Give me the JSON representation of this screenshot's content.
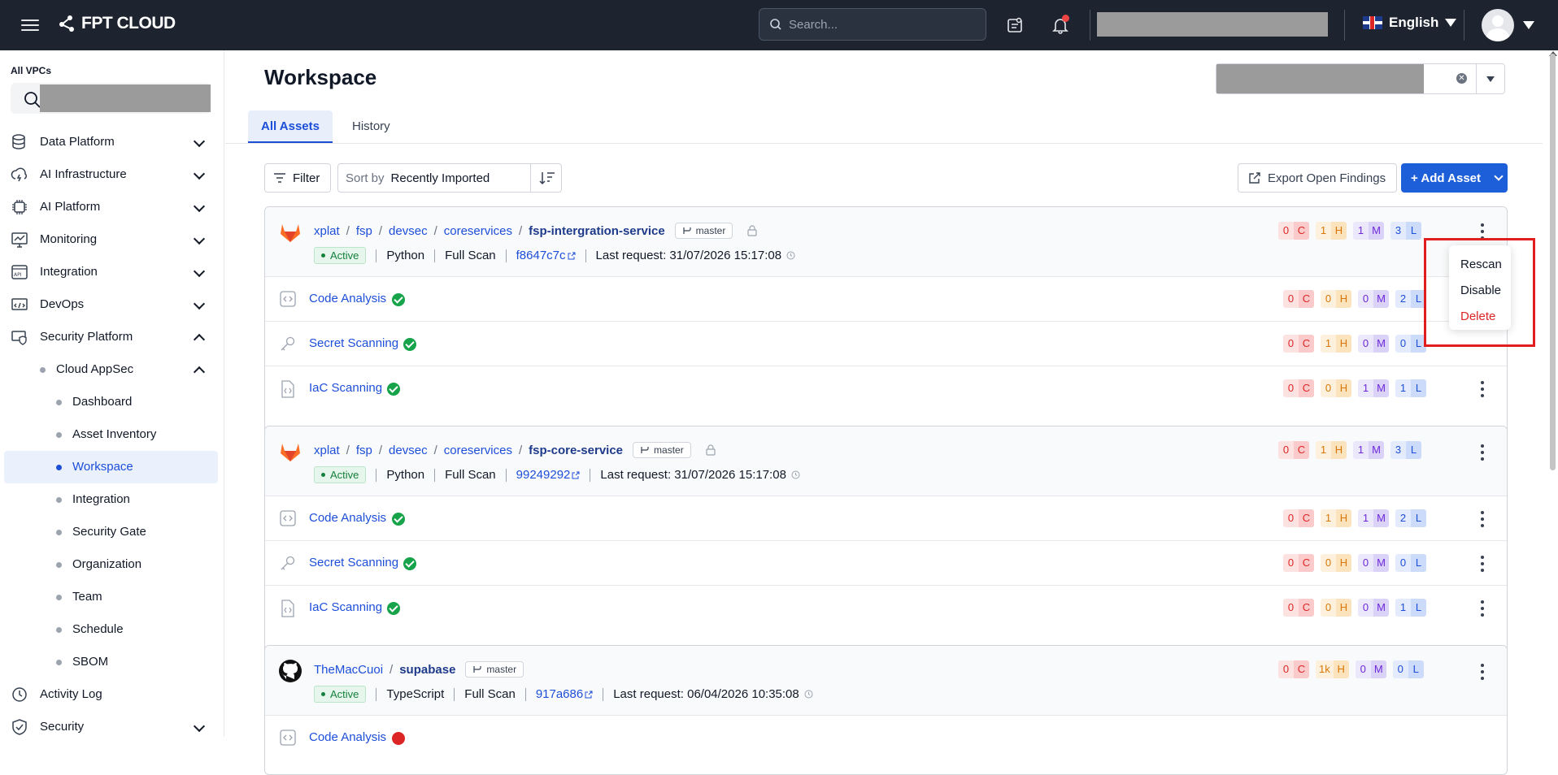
{
  "topbar": {
    "brand": "FPT CLOUD",
    "search_placeholder": "Search...",
    "language": "English"
  },
  "sidebar": {
    "title": "All VPCs",
    "items": [
      {
        "label": "Data Platform",
        "icon": "database-icon",
        "state": "collapsed"
      },
      {
        "label": "AI Infrastructure",
        "icon": "cloud-bolt-icon",
        "state": "collapsed"
      },
      {
        "label": "AI Platform",
        "icon": "ai-chip-icon",
        "state": "collapsed"
      },
      {
        "label": "Monitoring",
        "icon": "monitor-chart-icon",
        "state": "collapsed"
      },
      {
        "label": "Integration",
        "icon": "api-icon",
        "state": "collapsed"
      },
      {
        "label": "DevOps",
        "icon": "devops-icon",
        "state": "collapsed"
      },
      {
        "label": "Security Platform",
        "icon": "shield-icon",
        "state": "expanded"
      }
    ],
    "cloud_appsec": "Cloud AppSec",
    "subitems": [
      "Dashboard",
      "Asset Inventory",
      "Workspace",
      "Integration",
      "Security Gate",
      "Organization",
      "Team",
      "Schedule",
      "SBOM"
    ],
    "active_subitem": "Workspace",
    "activity_log": "Activity Log",
    "security": "Security"
  },
  "main": {
    "title": "Workspace",
    "tabs": [
      "All Assets",
      "History"
    ],
    "active_tab": "All Assets",
    "filter_label": "Filter",
    "sort_label": "Sort by",
    "sort_value": "Recently Imported",
    "export_label": "Export Open Findings",
    "add_label": "+ Add Asset"
  },
  "severity_letters": {
    "c": "C",
    "h": "H",
    "m": "M",
    "l": "L"
  },
  "assets": [
    {
      "path": [
        "xplat",
        "fsp",
        "devsec",
        "coreservices"
      ],
      "name": "fsp-intergration-service",
      "branch": "master",
      "status": "Active",
      "language": "Python",
      "scan": "Full Scan",
      "commit": "f8647c7c",
      "last_request": "Last request: 31/07/2026 15:17:08",
      "counts": {
        "c": "0",
        "h": "1",
        "m": "1",
        "l": "3"
      },
      "rows": [
        {
          "label": "Code Analysis",
          "counts": {
            "c": "0",
            "h": "0",
            "m": "0",
            "l": "2"
          }
        },
        {
          "label": "Secret Scanning",
          "counts": {
            "c": "0",
            "h": "1",
            "m": "0",
            "l": "0"
          }
        },
        {
          "label": "IaC Scanning",
          "counts": {
            "c": "0",
            "h": "0",
            "m": "1",
            "l": "1"
          }
        }
      ]
    },
    {
      "path": [
        "xplat",
        "fsp",
        "devsec",
        "coreservices"
      ],
      "name": "fsp-core-service",
      "branch": "master",
      "status": "Active",
      "language": "Python",
      "scan": "Full Scan",
      "commit": "99249292",
      "last_request": "Last request: 31/07/2026 15:17:08",
      "counts": {
        "c": "0",
        "h": "1",
        "m": "1",
        "l": "3"
      },
      "rows": [
        {
          "label": "Code Analysis",
          "counts": {
            "c": "0",
            "h": "1",
            "m": "1",
            "l": "2"
          }
        },
        {
          "label": "Secret Scanning",
          "counts": {
            "c": "0",
            "h": "0",
            "m": "0",
            "l": "0"
          }
        },
        {
          "label": "IaC Scanning",
          "counts": {
            "c": "0",
            "h": "0",
            "m": "0",
            "l": "1"
          }
        }
      ]
    },
    {
      "path": [
        "TheMacCuoi"
      ],
      "name": "supabase",
      "branch": "master",
      "status": "Active",
      "language": "TypeScript",
      "scan": "Full Scan",
      "commit": "917a686",
      "last_request": "Last request: 06/04/2026 10:35:08",
      "counts": {
        "c": "0",
        "h": "1k",
        "m": "0",
        "l": "0"
      },
      "rows": [
        {
          "label": "Code Analysis"
        }
      ]
    }
  ],
  "context_menu": {
    "items": [
      "Rescan",
      "Disable",
      "Delete"
    ],
    "danger_color": "#dc2626"
  },
  "colors": {
    "brand_blue": "#1d5fd8",
    "topbar": "#1d2430",
    "highlight": "#e01e1e"
  }
}
